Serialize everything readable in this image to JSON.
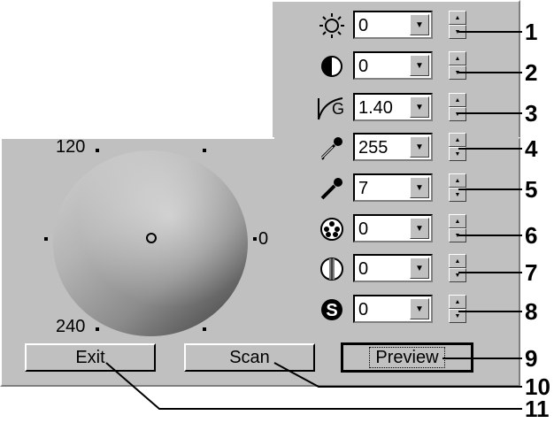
{
  "controls": [
    {
      "icon": "brightness-icon",
      "value": "0",
      "callout": "1"
    },
    {
      "icon": "contrast-icon",
      "value": "0",
      "callout": "2"
    },
    {
      "icon": "gamma-icon",
      "value": "1.40",
      "callout": "3"
    },
    {
      "icon": "highlight-eyedropper-icon",
      "value": "255",
      "callout": "4"
    },
    {
      "icon": "shadow-eyedropper-icon",
      "value": "7",
      "callout": "5"
    },
    {
      "icon": "saturation-icon",
      "value": "0",
      "callout": "6"
    },
    {
      "icon": "balance-icon",
      "value": "0",
      "callout": "7"
    },
    {
      "icon": "sharpen-icon",
      "value": "0",
      "callout": "8"
    }
  ],
  "gamma_letter": "G",
  "wheel": {
    "label_top": "120",
    "label_bottom": "240",
    "label_right": "0"
  },
  "buttons": {
    "exit": "Exit",
    "scan": "Scan",
    "preview": "Preview"
  },
  "callouts": {
    "preview": "9",
    "scan": "10",
    "exit": "11"
  }
}
